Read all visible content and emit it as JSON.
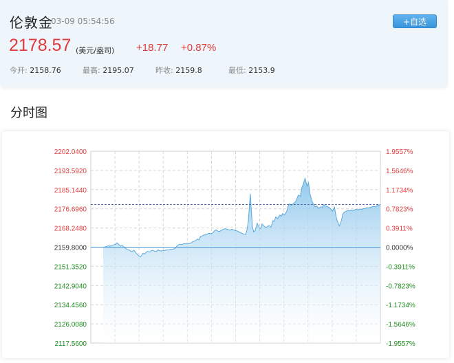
{
  "header": {
    "name": "伦敦金",
    "time": "03-09 05:54:56",
    "add_button": "+自选",
    "price": "2178.57",
    "unit": "(美元/盎司)",
    "change": "+18.77",
    "change_pct": "+0.87%",
    "stats": [
      {
        "label": "今开:",
        "value": "2158.76"
      },
      {
        "label": "最高:",
        "value": "2195.07"
      },
      {
        "label": "昨收:",
        "value": "2159.8"
      },
      {
        "label": "最低:",
        "value": "2153.9"
      }
    ]
  },
  "section_title": "分时图",
  "colors": {
    "up": "#e03b3b",
    "down": "#1e8a1e",
    "line": "#5aa9db",
    "fill": "#a9d3ef",
    "accent_button": "#3a95dc"
  },
  "chart_data": {
    "type": "area",
    "ylim": [
      2117.56,
      2202.04
    ],
    "base": 2159.8,
    "current": 2178.57,
    "left_ticks": [
      "2202.0400",
      "2193.5920",
      "2185.1440",
      "2176.6960",
      "2168.2480",
      "2159.8000",
      "2151.3520",
      "2142.9040",
      "2134.4560",
      "2126.0080",
      "2117.5600"
    ],
    "right_ticks": [
      "1.9557%",
      "1.5646%",
      "1.1734%",
      "0.7823%",
      "0.3911%",
      "0.0000%",
      "-0.3911%",
      "-0.7823%",
      "-1.1734%",
      "-1.5646%",
      "-1.9557%"
    ],
    "x": [
      0,
      2,
      5,
      8,
      10,
      12,
      15,
      18,
      20,
      22,
      25,
      28,
      30,
      32,
      35,
      38,
      40,
      42,
      45,
      48,
      50,
      52,
      55,
      58,
      60,
      62,
      65,
      68,
      70,
      72,
      75,
      78,
      80,
      82,
      85,
      88,
      90,
      92,
      95,
      98,
      100,
      102,
      105,
      108,
      110,
      112,
      115,
      118,
      120,
      122,
      125,
      128,
      130,
      132,
      135,
      138,
      140,
      142,
      145,
      148,
      150,
      152,
      155,
      158,
      160,
      162,
      165,
      168,
      170,
      172,
      175,
      178,
      180,
      182,
      185,
      188,
      190,
      192,
      195,
      198,
      200,
      202,
      205,
      208,
      210,
      212,
      215,
      218,
      220,
      222,
      225,
      228,
      230,
      232,
      235,
      238,
      240,
      242,
      245,
      248,
      250,
      252,
      255,
      258,
      260,
      262,
      265,
      268,
      270,
      272,
      275,
      278,
      280,
      282,
      285,
      288,
      290,
      292,
      295,
      298,
      300,
      302,
      305,
      308,
      310,
      312,
      315,
      318,
      320,
      322,
      325,
      328,
      330,
      332,
      335,
      338,
      340,
      342,
      345,
      348,
      350,
      352,
      355,
      358,
      360,
      362,
      365,
      368,
      370,
      372,
      375,
      378,
      380,
      382,
      385,
      388,
      390,
      392,
      395,
      398,
      400,
      402,
      405
    ],
    "values": [
      2159.8,
      2159.9,
      2160.2,
      2160.4,
      2160.1,
      2160.5,
      2160.8,
      2161.0,
      2161.7,
      2161.2,
      2160.3,
      2160.6,
      2160.0,
      2159.4,
      2158.8,
      2158.6,
      2158.0,
      2157.8,
      2158.4,
      2157.2,
      2156.6,
      2156.0,
      2155.6,
      2157.1,
      2156.8,
      2157.3,
      2158.0,
      2157.6,
      2158.2,
      2158.4,
      2158.1,
      2157.9,
      2158.6,
      2158.3,
      2158.1,
      2158.4,
      2158.3,
      2158.6,
      2158.5,
      2158.8,
      2158.7,
      2158.9,
      2159.2,
      2160.4,
      2160.9,
      2161.1,
      2161.0,
      2161.3,
      2161.2,
      2161.5,
      2161.4,
      2161.6,
      2162.1,
      2162.3,
      2162.7,
      2163.4,
      2163.0,
      2164.5,
      2164.8,
      2165.3,
      2165.1,
      2165.6,
      2165.9,
      2165.7,
      2166.1,
      2166.9,
      2167.4,
      2166.8,
      2166.7,
      2167.1,
      2167.6,
      2167.9,
      2167.8,
      2167.6,
      2167.3,
      2167.7,
      2167.5,
      2167.2,
      2167.0,
      2166.6,
      2166.2,
      2166.0,
      2165.6,
      2165.3,
      2167.3,
      2171.2,
      2183.3,
      2168.9,
      2166.5,
      2167.1,
      2170.3,
      2168.4,
      2167.9,
      2170.0,
      2169.1,
      2168.4,
      2168.9,
      2169.3,
      2168.6,
      2171.5,
      2171.2,
      2173.1,
      2172.5,
      2174.0,
      2173.3,
      2174.6,
      2174.1,
      2175.5,
      2177.6,
      2178.9,
      2178.2,
      2179.1,
      2179.5,
      2180.3,
      2182.7,
      2182.3,
      2185.8,
      2187.3,
      2190.1,
      2186.7,
      2188.2,
      2183.5,
      2180.1,
      2178.2,
      2177.5,
      2177.9,
      2176.9,
      2177.6,
      2177.3,
      2178.5,
      2177.9,
      2177.6,
      2177.3,
      2176.8,
      2175.6,
      2177.4,
      2173.6,
      2171.4,
      2169.1,
      2171.5,
      2174.3,
      2175.2,
      2175.6,
      2176.0,
      2175.8,
      2176.1,
      2175.9,
      2176.3,
      2176.5,
      2176.2,
      2176.6,
      2176.4,
      2176.8,
      2176.7,
      2177.2,
      2177.1,
      2177.3,
      2177.5,
      2177.8,
      2177.5,
      2178.1,
      2178.3,
      2178.6
    ]
  }
}
